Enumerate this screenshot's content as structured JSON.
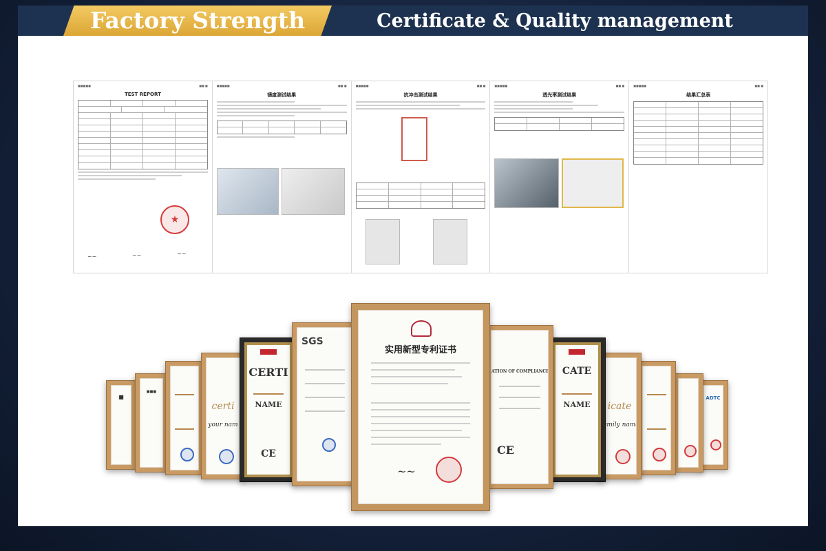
{
  "banner": {
    "title": "Factory Strength",
    "subtitle": "Certificate & Quality management",
    "colors": {
      "gold": "#e7b548",
      "navy": "#1d3250",
      "text": "#ffffff"
    }
  },
  "reports": [
    {
      "title": "TEST REPORT"
    },
    {
      "title": "镜度测试结果"
    },
    {
      "title": "抗冲击测试结果"
    },
    {
      "title": "透光率测试结果"
    },
    {
      "title": "结果汇总表"
    }
  ],
  "certificates": {
    "center": {
      "title": "实用新型专利证书"
    },
    "left": [
      {
        "text": "SGS"
      },
      {
        "text": "CERTI"
      },
      {
        "text": "NAME"
      },
      {
        "text": "certi"
      },
      {
        "text": "your nam"
      },
      {
        "text": "CE"
      }
    ],
    "right": [
      {
        "text": "ATION OF COMPLIANCE"
      },
      {
        "text": "CE"
      },
      {
        "text": "CATE"
      },
      {
        "text": "NAME"
      },
      {
        "text": "icate"
      },
      {
        "text": "amily name"
      },
      {
        "text": "ADTC"
      }
    ]
  }
}
